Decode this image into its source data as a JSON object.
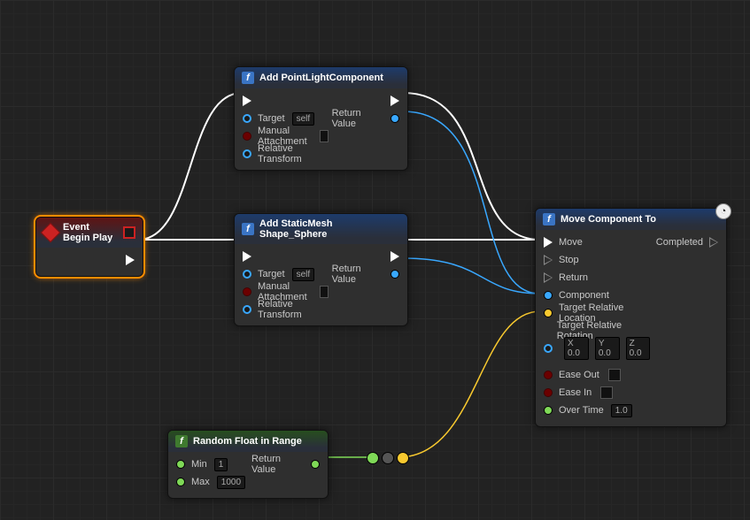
{
  "common": {
    "target": "Target",
    "self": "self",
    "manualAttachment": "Manual Attachment",
    "relativeTransform": "Relative Transform",
    "returnValue": "Return Value"
  },
  "nodes": {
    "eventBeginPlay": {
      "title": "Event Begin Play"
    },
    "addPointLight": {
      "title": "Add PointLightComponent"
    },
    "addStaticMesh": {
      "title": "Add StaticMesh Shape_Sphere"
    },
    "moveComponentTo": {
      "title": "Move Component To",
      "pins": {
        "move": "Move",
        "stop": "Stop",
        "return": "Return",
        "component": "Component",
        "targetLoc": "Target Relative Location",
        "targetRot": "Target Relative Rotation",
        "easeOut": "Ease Out",
        "easeIn": "Ease In",
        "overTime": "Over Time",
        "completed": "Completed"
      },
      "rot": {
        "xl": "X",
        "x": "0.0",
        "yl": "Y",
        "y": "0.0",
        "zl": "Z",
        "z": "0.0"
      },
      "overTime": "1.0"
    },
    "randomFloat": {
      "title": "Random Float in Range",
      "pins": {
        "min": "Min",
        "max": "Max"
      },
      "minVal": "1",
      "maxVal": "1000"
    }
  }
}
